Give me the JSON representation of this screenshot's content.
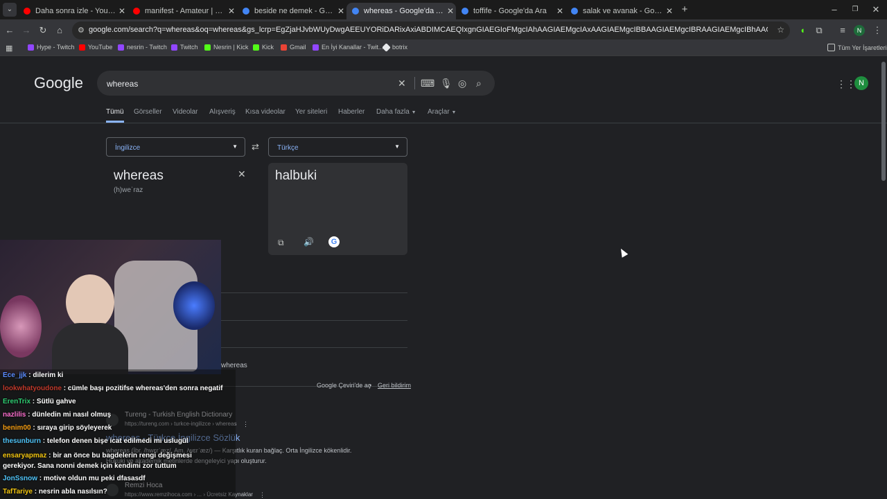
{
  "browser": {
    "tabs": [
      {
        "title": "Daha sonra izle - YouTube",
        "favicon_color": "#ff0000"
      },
      {
        "title": "manifest - Amateur | Official Mu",
        "favicon_color": "#ff0000"
      },
      {
        "title": "beside ne demek - Google'da Ara",
        "favicon_color": "#4285f4"
      },
      {
        "title": "whereas - Google'da Ara",
        "favicon_color": "#4285f4"
      },
      {
        "title": "toffife - Google'da Ara",
        "favicon_color": "#4285f4"
      },
      {
        "title": "salak ve avanak - Google'da Ara",
        "favicon_color": "#4285f4"
      }
    ],
    "new_tab_label": "+",
    "url": "google.com/search?q=whereas&oq=whereas&gs_lcrp=EgZjaHJvbWUyDwgAEEUYORiDARixAxiABDIMCAEQIxgnGIAEGIoFMgcIAhAAGIAEMgcIAxAAGIAEMgcIBBAAGIAEMgcIBRAAGIAEMgcIBhAAGIAEMgcIBxAAGIAEMgcICBAAGIAEMgcICR...",
    "profile_initial": "N",
    "bookmarks": [
      {
        "label": "Hype - Twitch",
        "color": "#9146ff"
      },
      {
        "label": "YouTube",
        "color": "#ff0000"
      },
      {
        "label": "nesrin - Twitch",
        "color": "#9146ff"
      },
      {
        "label": "Twitch",
        "color": "#9146ff"
      },
      {
        "label": "Nesrin | Kick",
        "color": "#53fc18"
      },
      {
        "label": "Kick",
        "color": "#53fc18"
      },
      {
        "label": "Gmail",
        "color": "#ea4335"
      },
      {
        "label": "En İyi Kanallar - Twit...",
        "color": "#9146ff"
      },
      {
        "label": "botrix",
        "color": "#e8eaed"
      }
    ],
    "all_bookmarks_label": "Tüm Yer İşaretleri"
  },
  "google": {
    "logo": "Google",
    "query": "whereas",
    "account_initial": "N",
    "nav_tabs": [
      "Tümü",
      "Görseller",
      "Videolar",
      "Alışveriş",
      "Kısa videolar",
      "Yer siteleri",
      "Haberler",
      "Daha fazla",
      "Araçlar"
    ],
    "translate": {
      "source_lang": "İngilizce",
      "target_lang": "Türkçe",
      "source_text": "whereas",
      "phonetic": "(h)weˈraz",
      "translation": "halbuki",
      "source_word_repeat": "whereas",
      "open_in_translate": "Google Çeviri'de aç",
      "feedback": "Geri bildirim"
    },
    "results": [
      {
        "site": "Tureng - Turkish English Dictionary",
        "url": "https://tureng.com › turkce-ingilizce › whereas",
        "title": "whereas - Türkçe İngilizce Sözlük",
        "snippet1": "whereas (İbr. /hwɛrˈæz/, Am. /wɛrˈæz/) — Karşıtlık kuran bağlaç. Orta İngilizce kökenlidir.",
        "snippet2": "Hukuki ve akademik metinlerde dengeleyici yapı oluşturur."
      },
      {
        "site": "Remzi Hoca",
        "url": "https://www.remzihoca.com › ... › Ücretsiz Kaynaklar"
      }
    ]
  },
  "stream": {
    "chat": [
      {
        "user": "Ece_jjk",
        "msg": "dilerim ki",
        "color": "#5b8cff"
      },
      {
        "user": "lookwhatyoudone",
        "msg": "cümle başı pozitifse whereas'den sonra negatif",
        "color": "#c0392b"
      },
      {
        "user": "ErenTrix",
        "msg": "Sütlü gahve",
        "color": "#2ecc71"
      },
      {
        "user": "nazlilis",
        "msg": "dünledin mi nasıl olmuş",
        "color": "#ff6fcf"
      },
      {
        "user": "benim00",
        "msg": "sıraya girip söyleyerek",
        "color": "#f39c12"
      },
      {
        "user": "thesunburn",
        "msg": "telefon denen bişe icat edilmedi mi uslugül",
        "color": "#4fc3f7"
      },
      {
        "user": "ensaryapmaz",
        "msg": "bir an önce bu bagdelerin rengi değişmesi gerekiyor. Sana nonni demek için kendimi zor tuttum",
        "color": "#f1c40f"
      },
      {
        "user": "JonSsnow",
        "msg": "motive oldun mu peki dfasasdf",
        "color": "#4fc3f7"
      },
      {
        "user": "TafTariye",
        "msg": "nesrin abla nasılsın?",
        "color": "#f1c40f"
      }
    ]
  }
}
